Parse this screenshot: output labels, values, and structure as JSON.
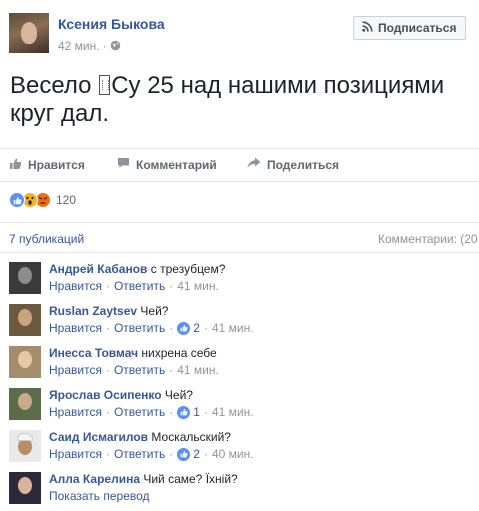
{
  "post": {
    "author": "Ксения Быкова",
    "time": "42 мин.",
    "subscribe_label": "Подписаться",
    "text_before": "Весело ",
    "text_after": "Су 25 над нашими позициями круг дал."
  },
  "actions": {
    "like": "Нравится",
    "comment": "Комментарий",
    "share": "Поделиться"
  },
  "reactions": {
    "count": "120",
    "icons": [
      "like-icon",
      "wow-icon",
      "angry-icon"
    ]
  },
  "stats": {
    "shares": "7 публикаций",
    "comments": "Комментарии: (20"
  },
  "comments": [
    {
      "name": "Андрей Кабанов",
      "text": "с трезубцем?",
      "like": "Нравится",
      "reply": "Ответить",
      "likes": "",
      "time": "41 мин."
    },
    {
      "name": "Ruslan Zaytsev",
      "text": "Чей?",
      "like": "Нравится",
      "reply": "Ответить",
      "likes": "2",
      "time": "41 мин."
    },
    {
      "name": "Инесса Товмач",
      "text": "нихрена себе",
      "like": "Нравится",
      "reply": "Ответить",
      "likes": "",
      "time": "41 мин."
    },
    {
      "name": "Ярослав Осипенко",
      "text": "Чей?",
      "like": "Нравится",
      "reply": "Ответить",
      "likes": "1",
      "time": "41 мин."
    },
    {
      "name": "Саид Исмагилов",
      "text": "Москальский?",
      "like": "Нравится",
      "reply": "Ответить",
      "likes": "2",
      "time": "40 мин."
    },
    {
      "name": "Алла Карелина",
      "text": "Чий саме? Їхній?",
      "translate": "Показать перевод"
    }
  ],
  "colors": {
    "link": "#365899",
    "muted": "#90949c",
    "text": "#1d2129",
    "like_blue": "#5890ff"
  }
}
